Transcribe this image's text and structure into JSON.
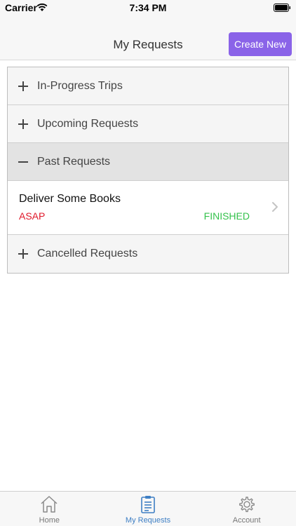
{
  "status_bar": {
    "carrier": "Carrier",
    "time": "7:34 PM"
  },
  "nav": {
    "title": "My Requests",
    "create_button": "Create New"
  },
  "accordion": {
    "sections": [
      {
        "label": "In-Progress Trips",
        "expanded": false
      },
      {
        "label": "Upcoming Requests",
        "expanded": false
      },
      {
        "label": "Past Requests",
        "expanded": true
      },
      {
        "label": "Cancelled Requests",
        "expanded": false
      }
    ],
    "past_requests": [
      {
        "title": "Deliver Some Books",
        "timing": "ASAP",
        "status": "FINISHED"
      }
    ]
  },
  "tab_bar": {
    "tabs": [
      {
        "label": "Home",
        "icon": "home-icon",
        "active": false
      },
      {
        "label": "My Requests",
        "icon": "clipboard-icon",
        "active": true
      },
      {
        "label": "Account",
        "icon": "gear-icon",
        "active": false
      }
    ]
  },
  "colors": {
    "accent": "#8a63e8",
    "active_tab": "#3e7fc4",
    "asap": "#e0182a",
    "finished": "#35c24c"
  }
}
